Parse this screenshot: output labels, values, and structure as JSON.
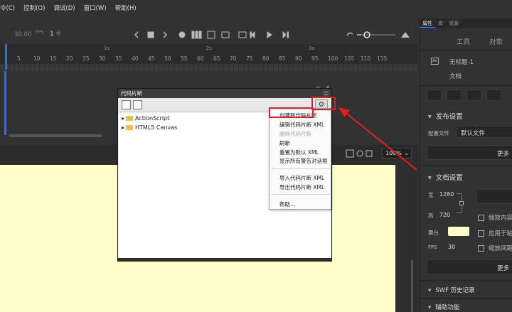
{
  "menu": [
    "令(C)",
    "控制(O)",
    "调试(D)",
    "窗口(W)",
    "帮助(H)"
  ],
  "timeline": {
    "fps_value": "30.00",
    "fps_unit": "FPS",
    "frame": "1",
    "frame_unit": "帧",
    "ticks": [
      "5",
      "10",
      "15",
      "20",
      "25",
      "30",
      "35",
      "40",
      "45",
      "50",
      "55",
      "60",
      "65",
      "70",
      "75",
      "80",
      "85",
      "90",
      "95",
      "100",
      "105",
      "110",
      "115"
    ],
    "seconds": [
      "1s",
      "2s",
      "3s"
    ]
  },
  "zoom": "100%",
  "dialog": {
    "title": "代码片断",
    "tree": [
      "ActionScript",
      "HTML5 Canvas"
    ]
  },
  "context_menu": {
    "items": [
      {
        "label": "创建新代码片断",
        "enabled": true
      },
      {
        "label": "编辑代码片断 XML",
        "enabled": true
      },
      {
        "label": "删除代码片断",
        "enabled": false
      },
      {
        "label": "刷新",
        "enabled": true
      },
      {
        "label": "重置为默认 XML",
        "enabled": true
      },
      {
        "label": "显示所有警告对话框",
        "enabled": true
      },
      {
        "label": "导入代码片断 XML",
        "enabled": true
      },
      {
        "label": "导出代码片断 XML",
        "enabled": true
      },
      {
        "label": "帮助...",
        "enabled": true
      }
    ]
  },
  "right_panel": {
    "tabs": [
      "属性",
      "库",
      "资源"
    ],
    "subtabs": [
      "工具",
      "对象"
    ],
    "doc_name": "无标题-1",
    "doc_type": "文档",
    "publish_header": "发布设置",
    "profile_label": "配置文件",
    "profile_value": "默认文件",
    "more_label": "更多",
    "doc_settings_header": "文档设置",
    "width_label": "宽",
    "width_value": "1280",
    "height_label": "高",
    "height_value": "720",
    "stage_label": "舞台",
    "stage_color": "#fefdc9",
    "fps_label": "FPS",
    "fps_value": "30",
    "check1": "缩放内容",
    "check2": "应用于粘",
    "check3": "缩放间距",
    "more2_label": "更多",
    "history_header": "SWF 历史记录",
    "accessibility_header": "辅助功能"
  },
  "accent": "#3b6fc2",
  "highlight_color": "#e02020"
}
